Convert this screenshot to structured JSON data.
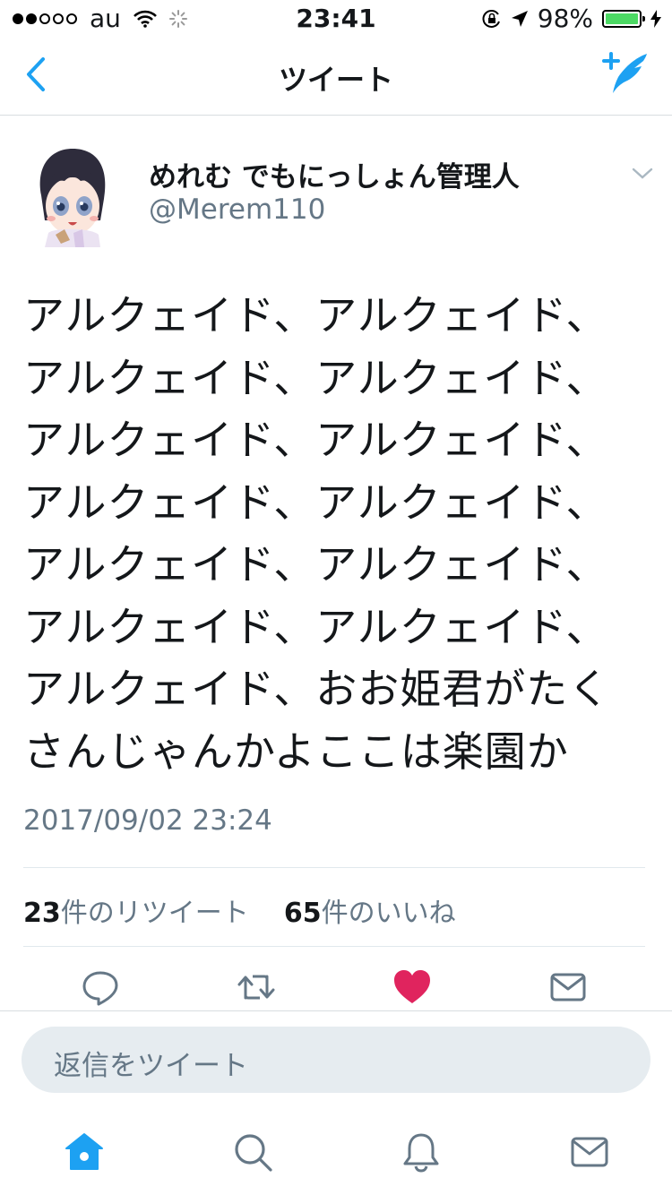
{
  "status_bar": {
    "carrier": "au",
    "time": "23:41",
    "battery": "98%",
    "battery_level": 0.98
  },
  "nav": {
    "title": "ツイート",
    "back_icon": "chevron-left-icon",
    "compose_icon": "compose-tweet-icon"
  },
  "tweet": {
    "display_name": "めれむ でもにっしょん管理人",
    "handle": "@Merem110",
    "text_lines": [
      "アルクェイド、アルクェイド、",
      "アルクェイド、アルクェイド、",
      "アルクェイド、アルクェイド、",
      "アルクェイド、アルクェイド、",
      "アルクェイド、アルクェイド、",
      "アルクェイド、アルクェイド、",
      "アルクェイド、おお姫君がたく",
      "さんじゃんかよここは楽園か"
    ],
    "timestamp": "2017/09/02 23:24",
    "retweet_count": "23",
    "retweet_label": "件のリツイート",
    "like_count": "65",
    "like_label": "件のいいね"
  },
  "actions": [
    "reply-icon",
    "retweet-icon",
    "like-icon",
    "share-mail-icon"
  ],
  "reply_box": {
    "placeholder": "返信をツイート"
  },
  "tab_bar": [
    "home-icon",
    "search-icon",
    "notifications-icon",
    "messages-icon"
  ],
  "colors": {
    "accent": "#1da1f2",
    "like": "#e0245e",
    "secondary_text": "#657786"
  }
}
